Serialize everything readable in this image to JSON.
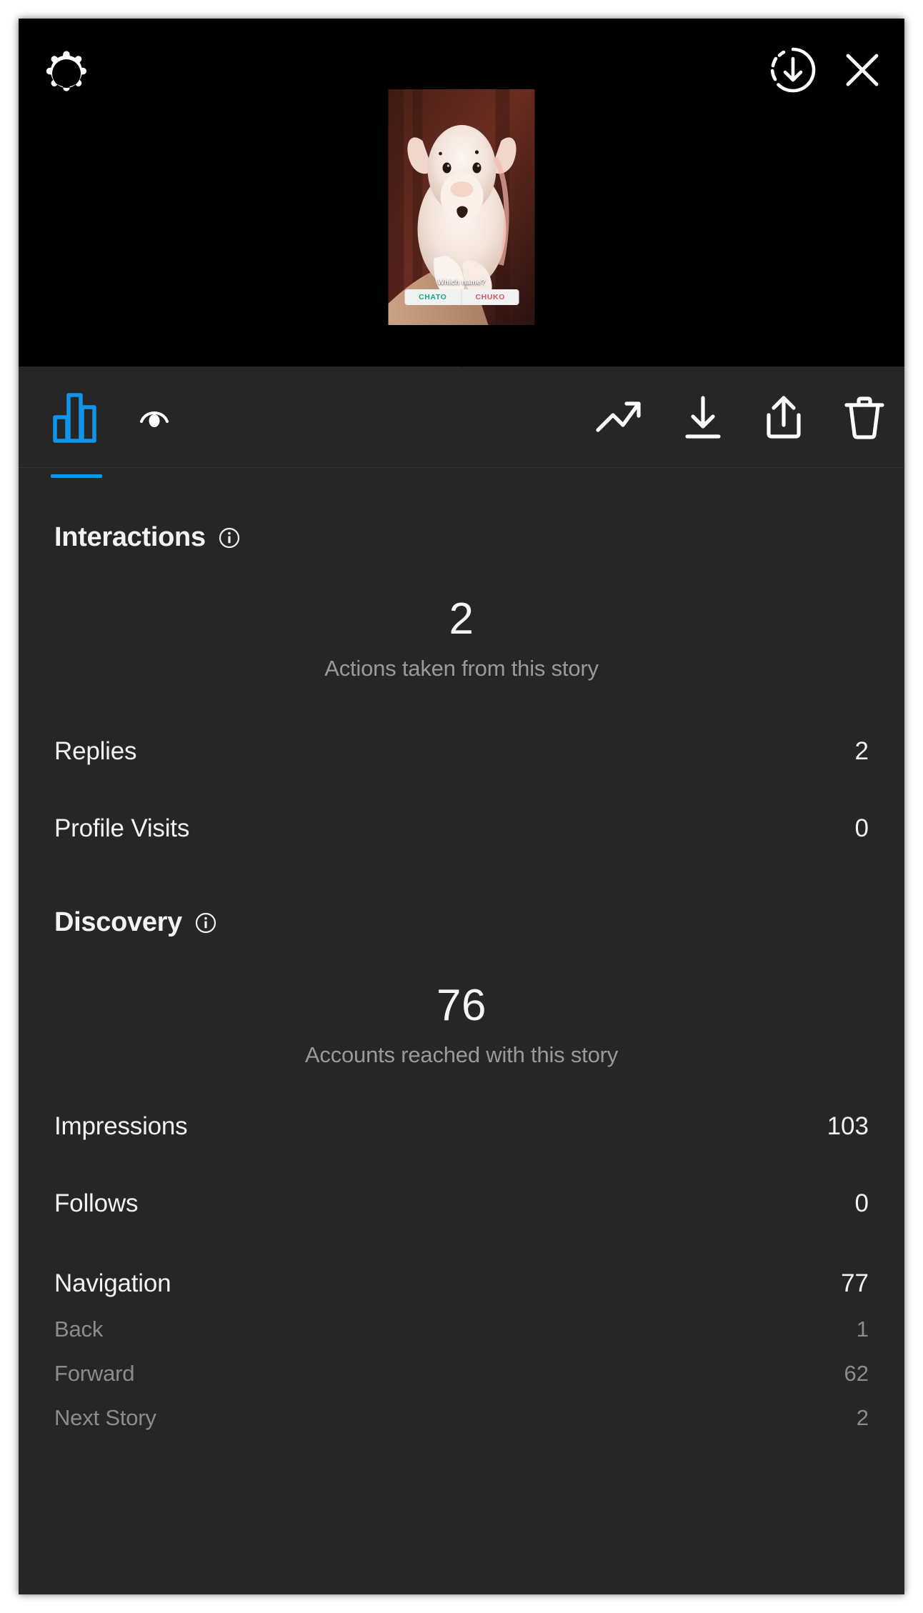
{
  "header": {
    "settings_icon": "gear-icon",
    "download_icon": "download-circle-icon",
    "close_icon": "close-x-icon"
  },
  "story_preview": {
    "alt": "white bull terrier puppy held in arms",
    "poll": {
      "question": "Which name?",
      "option_a": "CHATO",
      "option_b": "CHUKO",
      "option_a_color": "#17a589",
      "option_b_color": "#d4566c"
    }
  },
  "toolbar": {
    "tabs": [
      {
        "name": "insights-tab",
        "icon": "bar-chart-icon",
        "active": true
      },
      {
        "name": "viewers-tab",
        "icon": "eye-icon",
        "active": false
      }
    ],
    "actions": [
      {
        "name": "promote-action",
        "icon": "trending-up-icon"
      },
      {
        "name": "save-action",
        "icon": "download-icon"
      },
      {
        "name": "share-action",
        "icon": "share-up-icon"
      },
      {
        "name": "delete-action",
        "icon": "trash-icon"
      }
    ],
    "active_color": "#0f95eb"
  },
  "interactions": {
    "title": "Interactions",
    "info_icon": "info-circle-icon",
    "hero_value": "2",
    "hero_caption": "Actions taken from this story",
    "rows": [
      {
        "label": "Replies",
        "value": "2"
      },
      {
        "label": "Profile Visits",
        "value": "0"
      }
    ]
  },
  "discovery": {
    "title": "Discovery",
    "info_icon": "info-circle-icon",
    "hero_value": "76",
    "hero_caption": "Accounts reached with this story",
    "rows": [
      {
        "label": "Impressions",
        "value": "103"
      },
      {
        "label": "Follows",
        "value": "0"
      }
    ],
    "navigation": {
      "label": "Navigation",
      "value": "77",
      "breakdown": [
        {
          "label": "Back",
          "value": "1"
        },
        {
          "label": "Forward",
          "value": "62"
        },
        {
          "label": "Next Story",
          "value": "2"
        }
      ]
    }
  }
}
